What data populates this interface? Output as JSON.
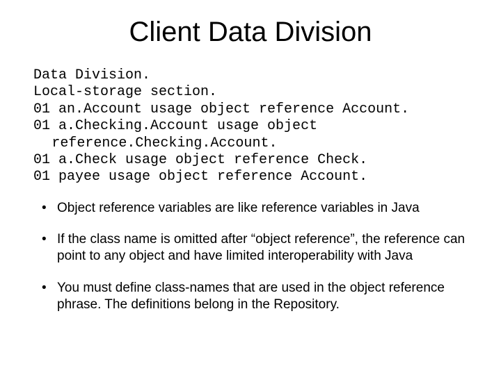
{
  "title": "Client Data Division",
  "code": {
    "l1": "Data Division.",
    "l2": "Local-storage section.",
    "l3": "01 an.Account usage object reference Account.",
    "l4": "01 a.Checking.Account usage object",
    "l4b": "reference.Checking.Account.",
    "l5": "01 a.Check usage object reference Check.",
    "l6": "01 payee usage object reference Account."
  },
  "bullets": {
    "b1": "Object reference variables are like reference variables in Java",
    "b2": "If the class name is omitted after “object reference”, the reference can point to any object and have limited interoperability with Java",
    "b3": "You must define class-names that are used in the object reference phrase.  The definitions belong in the Repository."
  }
}
